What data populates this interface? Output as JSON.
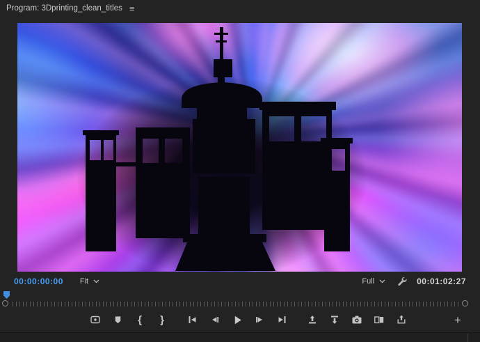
{
  "panel": {
    "title": "Program: 3Dprinting_clean_titles",
    "menu_icon": "≡"
  },
  "controls": {
    "current_timecode": "00:00:00:00",
    "zoom_level": "Fit",
    "playback_resolution": "Full",
    "duration_timecode": "00:01:02:27"
  },
  "transport": {
    "buttons": [
      {
        "id": "loop-playback",
        "icon": "loop-icon"
      },
      {
        "id": "add-marker",
        "icon": "marker-flag-icon"
      },
      {
        "id": "mark-in",
        "glyph": "{"
      },
      {
        "id": "mark-out",
        "glyph": "}"
      },
      {
        "id": "go-to-in",
        "icon": "bar-triangle-left-icon"
      },
      {
        "id": "step-back",
        "icon": "triangle-left-bar-icon"
      },
      {
        "id": "play",
        "icon": "play-triangle-icon"
      },
      {
        "id": "step-forward",
        "icon": "bar-triangle-right-icon"
      },
      {
        "id": "go-to-out",
        "icon": "triangle-right-bar-icon"
      },
      {
        "id": "lift",
        "icon": "arrow-up-frame-icon"
      },
      {
        "id": "extract",
        "icon": "arrow-down-frame-icon"
      },
      {
        "id": "export-frame",
        "icon": "camera-icon"
      },
      {
        "id": "comparison-view",
        "icon": "dual-frames-icon"
      },
      {
        "id": "export",
        "icon": "share-arrow-icon"
      },
      {
        "id": "button-editor",
        "glyph": "+"
      }
    ]
  },
  "colors": {
    "timecode_blue": "#459df5",
    "playhead_blue": "#3f8ee0",
    "panel_bg": "#232323",
    "icon_gray": "#c3c3c3"
  },
  "video": {
    "content_description": "psychedelic pink-blue tie-dye burst with black 3D-printer silhouette"
  }
}
